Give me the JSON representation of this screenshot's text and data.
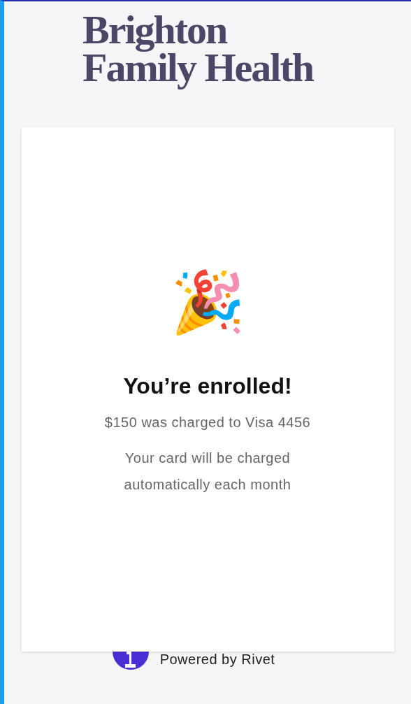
{
  "brand": {
    "lines": [
      "Brighton",
      "Family Health"
    ]
  },
  "card": {
    "emoji": "🎉",
    "title": "You’re enrolled!",
    "charge": "$150 was charged to Visa 4456",
    "note_lines": [
      "Your card will be charged",
      "automatically each month"
    ]
  },
  "footer": {
    "text": "Powered by Rivet"
  }
}
